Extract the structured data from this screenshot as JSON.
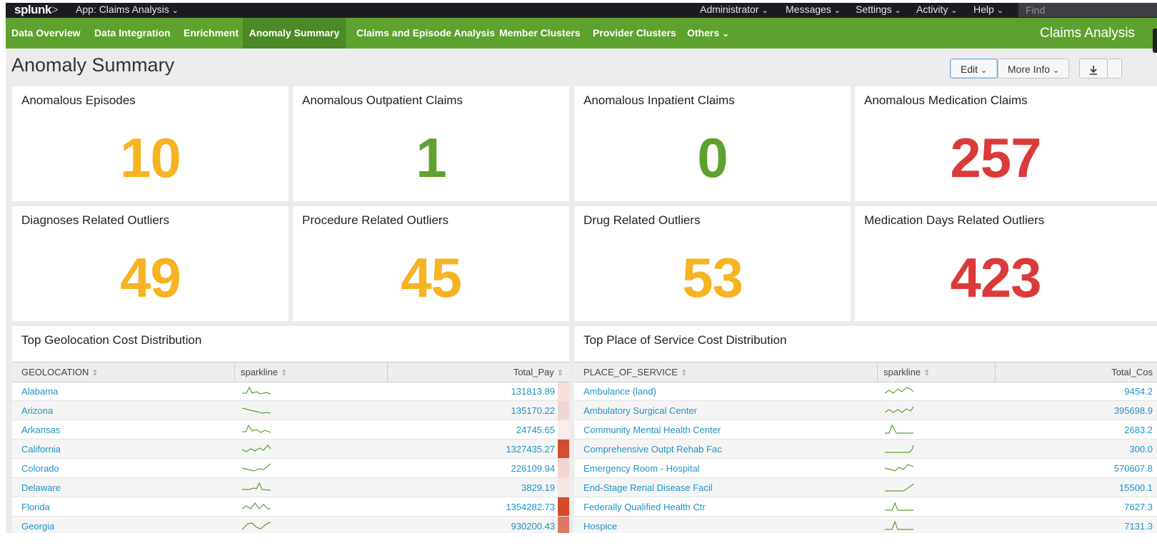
{
  "topbar": {
    "logo": "splunk",
    "logo_suffix": ">",
    "app": "App: Claims Analysis",
    "menus": [
      "Administrator",
      "Messages",
      "Settings",
      "Activity",
      "Help"
    ],
    "find_placeholder": "Find"
  },
  "nav": {
    "items": [
      "Data Overview",
      "Data Integration",
      "Enrichment",
      "Anomaly Summary",
      "Claims and Episode Analysis",
      "Member Clusters",
      "Provider Clusters",
      "Others"
    ],
    "active": "Anomaly Summary",
    "app_title": "Claims Analysis"
  },
  "page": {
    "title": "Anomaly Summary",
    "edit_label": "Edit",
    "more_info_label": "More Info",
    "download_icon": "download-icon"
  },
  "panels": {
    "episodes": {
      "title": "Anomalous Episodes",
      "value": "10"
    },
    "outpatient": {
      "title": "Anomalous Outpatient Claims",
      "value": "1"
    },
    "inpatient": {
      "title": "Anomalous Inpatient Claims",
      "value": "0"
    },
    "medication": {
      "title": "Anomalous Medication Claims",
      "value": "257"
    },
    "diagnoses": {
      "title": "Diagnoses Related Outliers",
      "value": "49"
    },
    "procedure": {
      "title": "Procedure Related Outliers",
      "value": "45"
    },
    "drug": {
      "title": "Drug Related Outliers",
      "value": "53"
    },
    "med_days": {
      "title": "Medication Days Related Outliers",
      "value": "423"
    }
  },
  "colors": {
    "yellow": "#f6b322",
    "green": "#5da22e",
    "red": "#dc3a3a",
    "link": "#1e93c6",
    "nav_green": "#5da22e"
  },
  "geo_table": {
    "title": "Top Geolocation Cost Distribution",
    "columns": [
      "GEOLOCATION",
      "sparkline",
      "Total_Pay"
    ],
    "rows": [
      {
        "name": "Alabama",
        "value": "131813.89"
      },
      {
        "name": "Arizona",
        "value": "135170.22"
      },
      {
        "name": "Arkansas",
        "value": "24745.65"
      },
      {
        "name": "California",
        "value": "1327435.27"
      },
      {
        "name": "Colorado",
        "value": "226109.94"
      },
      {
        "name": "Delaware",
        "value": "3829.19"
      },
      {
        "name": "Florida",
        "value": "1354282.73"
      },
      {
        "name": "Georgia",
        "value": "930200.43"
      }
    ]
  },
  "pos_table": {
    "title": "Top Place of Service Cost Distribution",
    "columns": [
      "PLACE_OF_SERVICE",
      "sparkline",
      "Total_Cos"
    ],
    "rows": [
      {
        "name": "Ambulance (land)",
        "value": "9454.2"
      },
      {
        "name": "Ambulatory Surgical Center",
        "value": "395698.9"
      },
      {
        "name": "Community Mental Health Center",
        "value": "2683.2"
      },
      {
        "name": "Comprehensive Outpt Rehab Fac",
        "value": "300.0"
      },
      {
        "name": "Emergency Room - Hospital",
        "value": "570607.8"
      },
      {
        "name": "End-Stage Renal Disease Facil",
        "value": "15500.1"
      },
      {
        "name": "Federally Qualified Health Ctr",
        "value": "7627.3"
      },
      {
        "name": "Hospice",
        "value": "7131.3"
      }
    ]
  }
}
